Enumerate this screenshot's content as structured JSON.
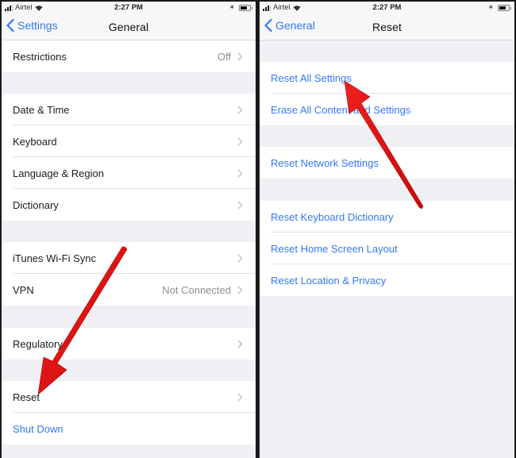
{
  "left_screen": {
    "status_bar": {
      "carrier": "Airtel",
      "time": "2:27 PM"
    },
    "nav": {
      "back_label": "Settings",
      "title": "General"
    },
    "rows": [
      {
        "label": "Restrictions",
        "detail": "Off"
      },
      {
        "label": "Date & Time"
      },
      {
        "label": "Keyboard"
      },
      {
        "label": "Language & Region"
      },
      {
        "label": "Dictionary"
      },
      {
        "label": "iTunes Wi-Fi Sync"
      },
      {
        "label": "VPN",
        "detail": "Not Connected"
      },
      {
        "label": "Regulatory"
      },
      {
        "label": "Reset"
      },
      {
        "label": "Shut Down"
      }
    ]
  },
  "right_screen": {
    "status_bar": {
      "carrier": "Airtel",
      "time": "2:27 PM"
    },
    "nav": {
      "back_label": "General",
      "title": "Reset"
    },
    "rows": [
      {
        "label": "Reset All Settings"
      },
      {
        "label": "Erase All Content and Settings"
      },
      {
        "label": "Reset Network Settings"
      },
      {
        "label": "Reset Keyboard Dictionary"
      },
      {
        "label": "Reset Home Screen Layout"
      },
      {
        "label": "Reset Location & Privacy"
      }
    ]
  },
  "annotations": {
    "left_arrow_target": "Reset",
    "right_arrow_target": "Reset All Settings",
    "arrow_color": "#e01010"
  },
  "colors": {
    "ios_blue": "#3478f6",
    "group_background": "#efeff4",
    "nav_background": "#f7f7f7",
    "detail_gray": "#8e8e93"
  }
}
